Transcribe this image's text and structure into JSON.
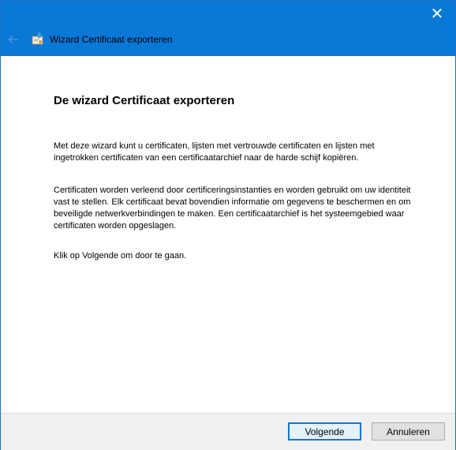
{
  "window": {
    "title": "Wizard Certificaat exporteren",
    "close_glyph": "✕",
    "accent_color": "#0a78d7"
  },
  "icons": {
    "back": "back-arrow-icon",
    "wizard": "certificate-export-icon",
    "close": "close-icon"
  },
  "content": {
    "heading": "De wizard Certificaat exporteren",
    "paragraph_1": "Met deze wizard kunt u certificaten, lijsten met vertrouwde certificaten en lijsten met ingetrokken certificaten van een certificaatarchief naar de harde schijf kopiëren.",
    "paragraph_2": "Certificaten worden verleend door certificeringsinstanties en worden gebruikt om uw identiteit vast te stellen. Elk certificaat bevat bovendien informatie om gegevens te beschermen en om beveiligde netwerkverbindingen te maken. Een certificaatarchief is het systeemgebied waar certificaten worden opgeslagen.",
    "paragraph_3": "Klik op Volgende om door te gaan."
  },
  "footer": {
    "next_label": "Volgende",
    "cancel_label": "Annuleren"
  }
}
